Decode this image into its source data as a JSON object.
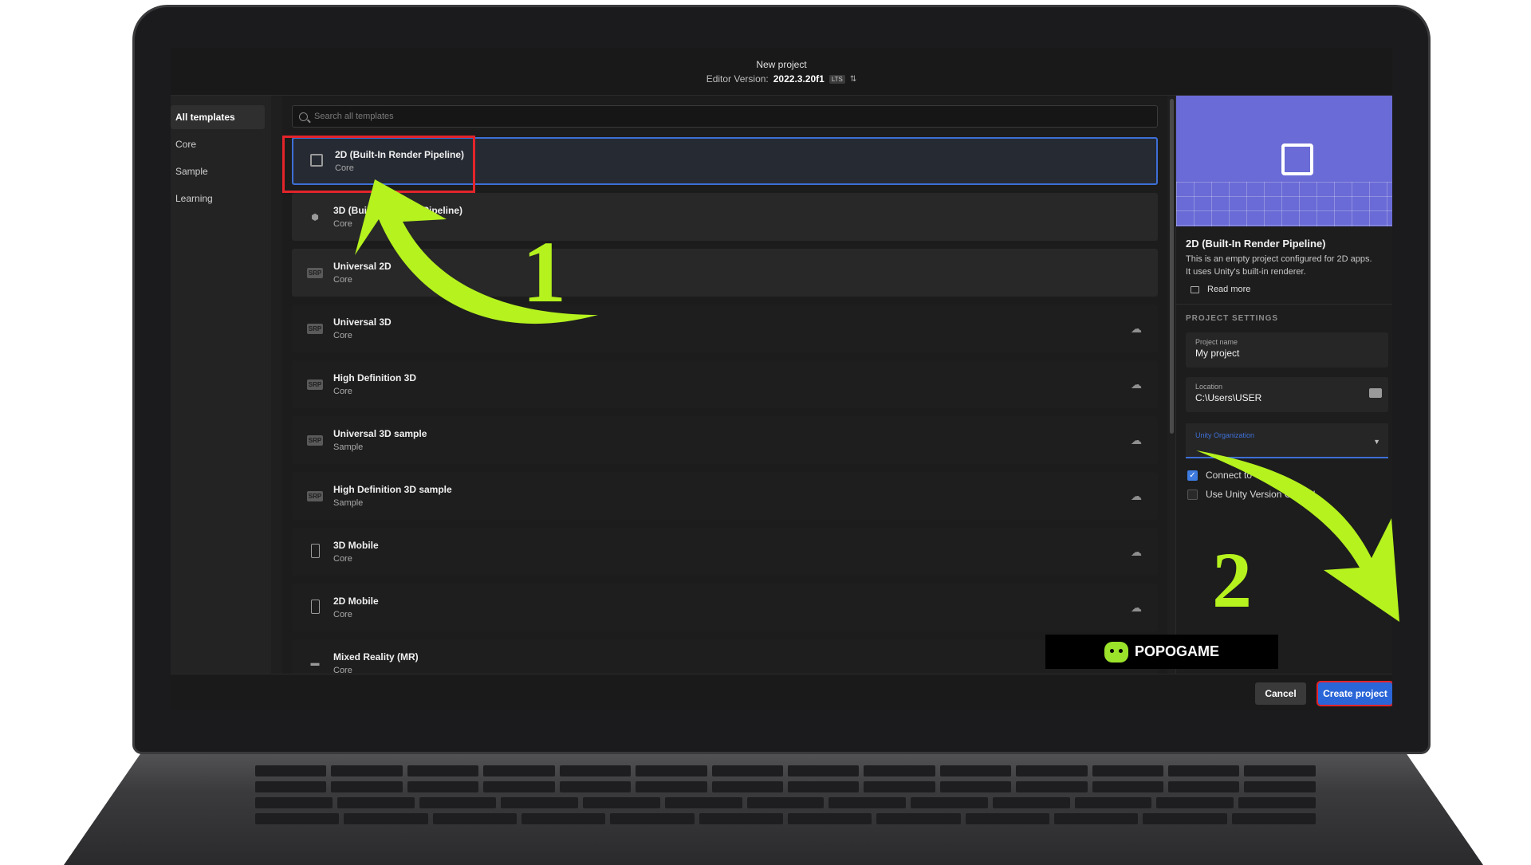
{
  "window": {
    "title": "New project",
    "editor_version_label": "Editor Version:",
    "editor_version": "2022.3.20f1",
    "version_badge": "LTS"
  },
  "sidebar": {
    "items": [
      {
        "label": "All templates"
      },
      {
        "label": "Core"
      },
      {
        "label": "Sample"
      },
      {
        "label": "Learning"
      }
    ]
  },
  "search": {
    "placeholder": "Search all templates"
  },
  "templates": [
    {
      "name": "2D (Built-In Render Pipeline)",
      "category": "Core",
      "icon": "square-icon",
      "cloud": false
    },
    {
      "name": "3D (Built-In Render Pipeline)",
      "category": "Core",
      "icon": "cube-icon",
      "cloud": false
    },
    {
      "name": "Universal 2D",
      "category": "Core",
      "icon": "srp-icon",
      "cloud": false
    },
    {
      "name": "Universal 3D",
      "category": "Core",
      "icon": "srp-icon",
      "cloud": true
    },
    {
      "name": "High Definition 3D",
      "category": "Core",
      "icon": "srp-icon",
      "cloud": true
    },
    {
      "name": "Universal 3D sample",
      "category": "Sample",
      "icon": "srp-icon",
      "cloud": true
    },
    {
      "name": "High Definition 3D sample",
      "category": "Sample",
      "icon": "srp-icon",
      "cloud": true
    },
    {
      "name": "3D Mobile",
      "category": "Core",
      "icon": "phone-icon",
      "cloud": true
    },
    {
      "name": "2D Mobile",
      "category": "Core",
      "icon": "phone-icon",
      "cloud": true
    },
    {
      "name": "Mixed Reality (MR)",
      "category": "Core",
      "icon": "headset-icon",
      "cloud": false
    }
  ],
  "srp_badge": "SRP",
  "details": {
    "title": "2D (Built-In Render Pipeline)",
    "description_line1": "This is an empty project configured for 2D apps.",
    "description_line2": "It uses Unity's built-in renderer.",
    "read_more": "Read more",
    "section_heading": "PROJECT SETTINGS",
    "project_name_label": "Project name",
    "project_name": "My project",
    "location_label": "Location",
    "location": "C:\\Users\\USER",
    "org_label": "Unity Organization",
    "connect_label": "Connect to Unity",
    "connect_checked": true,
    "vc_label": "Use Unity Version Control",
    "vc_checked": false
  },
  "footer": {
    "cancel": "Cancel",
    "create": "Create project"
  },
  "annotations": {
    "step1": "1",
    "step2": "2",
    "arrow_color": "#b5f21e",
    "highlight_color": "#e3242b"
  },
  "watermark": {
    "text": "POPOGAME"
  }
}
